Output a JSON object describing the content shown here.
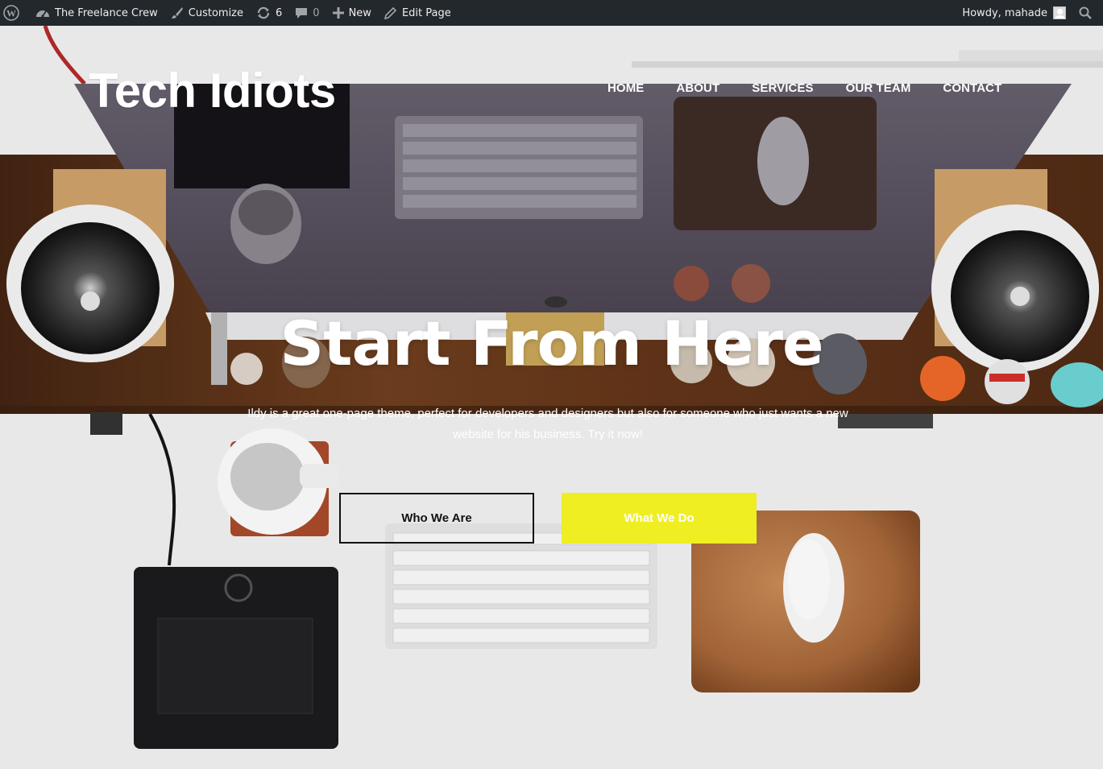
{
  "adminbar": {
    "site_name": "The Freelance Crew",
    "customize": "Customize",
    "updates_count": "6",
    "comments_count": "0",
    "new_label": "New",
    "edit_label": "Edit Page",
    "howdy": "Howdy, mahade"
  },
  "site": {
    "title": "Tech Idiots"
  },
  "nav": {
    "items": [
      "HOME",
      "ABOUT",
      "SERVICES",
      "OUR TEAM",
      "CONTACT"
    ]
  },
  "hero": {
    "title": "Start From Here",
    "subtitle": "Ildy is a great one-page theme, perfect for developers and designers but also for someone who just wants a new website for his business. Try it now!",
    "button_primary": "Who We Are",
    "button_secondary": "What We Do"
  },
  "colors": {
    "adminbar_bg": "#23282d",
    "accent_yellow": "#eeee22",
    "desk_wood": "#6b3a1c"
  }
}
